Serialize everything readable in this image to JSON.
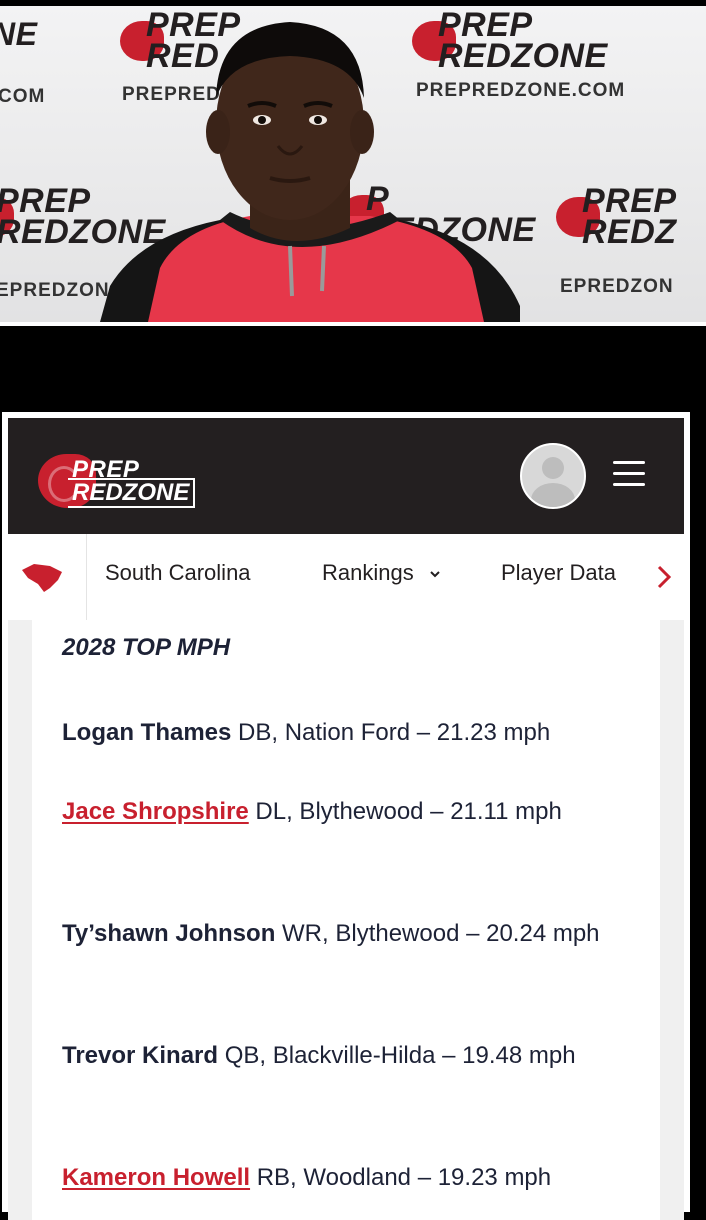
{
  "photo": {
    "backdrop_brand_line1": "PREP",
    "backdrop_brand_line2": "REDZONE",
    "backdrop_url": "PREPREDZONE.COM",
    "backdrop_url_partial": "PREPREDZON",
    "backdrop_url_left": "COM",
    "backdrop_partial_ne": "NE",
    "backdrop_partial_red": "RED",
    "backdrop_partial_redz": "REDZ",
    "backdrop_partial_prepred": "PREPRED",
    "backdrop_partial_epredzon": "EPREDZON",
    "backdrop_partial_p": "P"
  },
  "header": {
    "logo_line1": "PREP",
    "logo_line2": "REDZONE",
    "avatar_icon": "user-avatar-icon",
    "menu_icon": "hamburger-icon"
  },
  "subnav": {
    "state_icon": "south-carolina-map-icon",
    "items": [
      {
        "label": "South Carolina"
      },
      {
        "label": "Rankings"
      },
      {
        "label": "Player Data"
      }
    ],
    "dropdown_icon": "chevron-down-icon",
    "scroll_icon": "chevron-right-icon"
  },
  "article": {
    "heading": "2028 TOP MPH",
    "entries": [
      {
        "name": "Logan Thames",
        "linked": false,
        "detail": " DB, Nation Ford – 21.23 mph"
      },
      {
        "name": "Jace Shropshire",
        "linked": true,
        "detail": " DL, Blythewood – 21.11 mph"
      },
      {
        "name": "Ty’shawn Johnson",
        "linked": false,
        "detail": " WR, Blythewood – 20.24 mph"
      },
      {
        "name": "Trevor Kinard",
        "linked": false,
        "detail": " QB, Blackville-Hilda – 19.48 mph"
      },
      {
        "name": "Kameron Howell",
        "linked": true,
        "detail": " RB, Woodland – 19.23 mph"
      }
    ]
  },
  "colors": {
    "brand_red": "#c8202e",
    "header_dark": "#231f20",
    "text_navy": "#1d2236"
  }
}
